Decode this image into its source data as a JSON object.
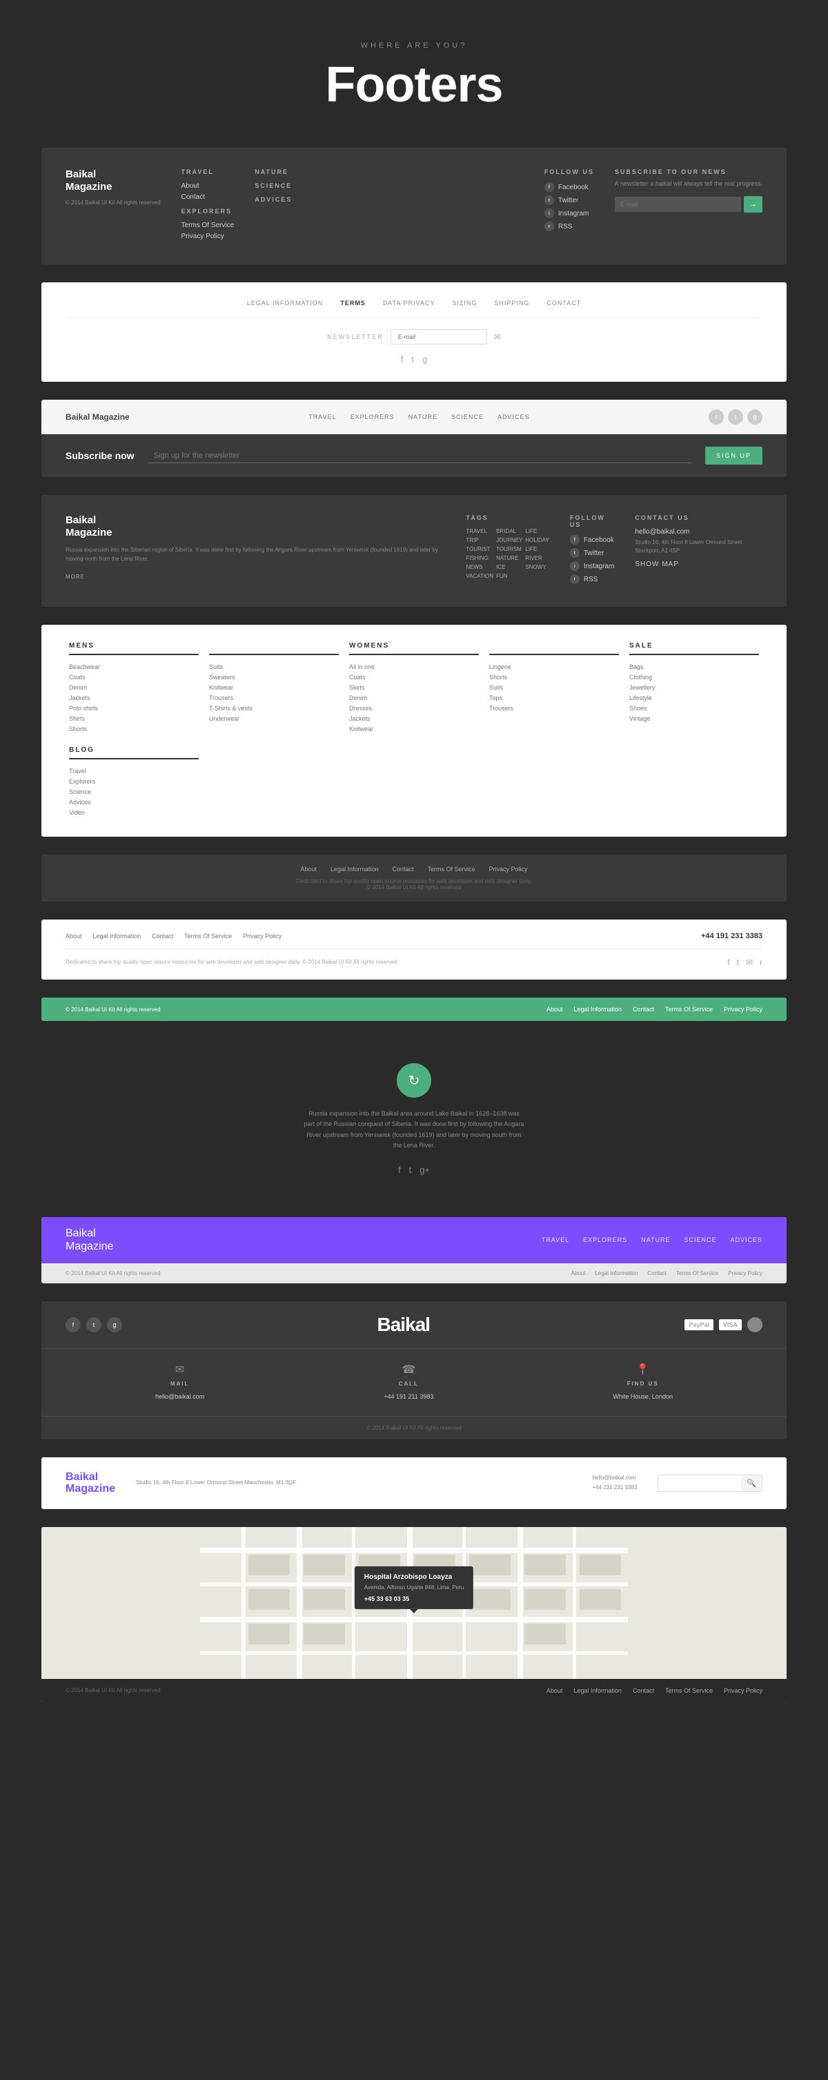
{
  "hero": {
    "subtitle": "WHERE ARE YOU?",
    "title": "Footers"
  },
  "footer1": {
    "brand_name": "Baikal",
    "brand_name2": "Magazine",
    "brand_copy": "© 2014 Baikal UI Kit\nAll rights reserved",
    "nav": {
      "col1_title": "TRAVEL",
      "col1_links": [
        "About",
        "Contact"
      ],
      "col2_title": "EXPLORERS",
      "col2_links": [
        "Terms Of Service",
        "Privacy Policy"
      ],
      "col3_title": "NATURE",
      "col4_title": "SCIENCE",
      "col5_title": "ADVICES"
    },
    "follow_title": "FOLLOW US",
    "social_links": [
      "Facebook",
      "Twitter",
      "Instagram",
      "RSS"
    ],
    "subscribe_title": "SUBSCRIBE TO OUR NEWS",
    "subscribe_desc": "A newsletter a baikal will always\ntell the real progress.",
    "subscribe_placeholder": "E-mail",
    "subscribe_btn": "→"
  },
  "footer2": {
    "nav_links": [
      "LEGAL INFORMATION",
      "TERMS",
      "DATA PRIVACY",
      "SIZING",
      "SHIPPING",
      "CONTACT"
    ],
    "newsletter_label": "NEWSLETTER",
    "newsletter_placeholder": "E-mail"
  },
  "footer3": {
    "brand": "Baikal",
    "brand2": " Magazine",
    "nav_links": [
      "TRAVEL",
      "EXPLORERS",
      "NATURE",
      "SCIENCE",
      "ADVICES"
    ]
  },
  "footer4": {
    "label": "Subscribe now",
    "placeholder": "Sign up for the newsletter",
    "btn": "SIGN UP"
  },
  "footer5": {
    "brand_name": "Baikal",
    "brand_name2": "Magazine",
    "brand_desc": "Russia expansion into the\nSiberian region of Siberia. It\nwas done first by following the\nAngara River upstream from\nYeniseisk (founded 1619) and later\nby moving north from the Lena\nRiver.",
    "more": "MORE",
    "tags_title": "TAGS",
    "tags": [
      "TRAVEL",
      "BRIDAL",
      "LIFE",
      "TRIP",
      "JOURNEY",
      "HOLIDAY",
      "TOURIST",
      "TOURISM",
      "LIFE",
      "FISHING",
      "NATURE",
      "RIVER",
      "NEWS",
      "ICE",
      "SNOWY",
      "VACATION",
      "FUN"
    ],
    "follow_title": "FOLLOW US",
    "social_links": [
      "Facebook",
      "Twitter",
      "Instagram",
      "RSS"
    ],
    "contact_title": "CONTACT US",
    "contact_email": "hello@baikal.com",
    "contact_address": "Studio 16, 4th Floor\n8 Lower Ormond Street\nStockport, A1 4SP",
    "show_map": "SHOW MAP"
  },
  "footer6": {
    "cols": [
      {
        "title": "MENS",
        "links": [
          "Beachwear",
          "Coats",
          "Denim",
          "Jackets",
          "Polo shirts",
          "Shirts",
          "Shorts"
        ]
      },
      {
        "title": "",
        "links": [
          "Suits",
          "Sweaters",
          "Knitwear",
          "Trousers",
          "T-Shirts & vests",
          "Underwear"
        ]
      },
      {
        "title": "WOMENS",
        "links": [
          "All in one",
          "Coats",
          "Skirts",
          "Denim",
          "Dresses",
          "Jackets",
          "Knitwear"
        ]
      },
      {
        "title": "",
        "links": [
          "Lingerie",
          "Shorts",
          "Suits",
          "Tops",
          "Trousers"
        ]
      },
      {
        "title": "SALE",
        "links": [
          "Bags",
          "Clothing",
          "Jewellery",
          "Lifestyle",
          "Shoes",
          "Vintage"
        ]
      },
      {
        "title": "BLOG",
        "links": [
          "Travel",
          "Explorers",
          "Science",
          "Advices",
          "Video"
        ]
      }
    ]
  },
  "footer7": {
    "nav_links": [
      "About",
      "Legal Information",
      "Contact",
      "Terms Of Service",
      "Privacy Policy"
    ],
    "copy": "Dedicated to share top quality open source resources for web developer and web designer daily.",
    "copy2": "© 2014 Baikal UI Kit All rights reserved"
  },
  "footer8": {
    "nav_links": [
      "About",
      "Legal Information",
      "Contact",
      "Terms Of Service",
      "Privacy Policy"
    ],
    "phone": "+44 191 231 3383",
    "copy": "Dedicated to share top quality open source resources for web developer and web designer daily.\n© 2014 Baikal UI Kit All rights reserved"
  },
  "footer9": {
    "copy": "© 2014 Baikal UI Kit All rights reserved",
    "nav_links": [
      "About",
      "Legal Information",
      "Contact",
      "Terms Of Service",
      "Privacy Policy"
    ]
  },
  "footer10": {
    "desc": "Russia expansion into the Baikal area around Lake Baikal in 1628–1638 was part of the Russian conquest of Siberia. It was done first by following the Angara River upstream from Yeniseisk (founded 1619) and later by moving south from the Lena River.",
    "social_links": [
      "f",
      "t",
      "g+"
    ]
  },
  "footer11": {
    "brand": "Baikal",
    "brand2": "Magazine",
    "top_nav": [
      "TRAVEL",
      "EXPLORERS",
      "NATURE",
      "SCIENCE",
      "ADVICES"
    ],
    "copy": "© 2014 Baikal UI Kit All rights reserved",
    "bottom_nav": [
      "About",
      "Legal Information",
      "Contact",
      "Terms Of Service",
      "Privacy Policy"
    ]
  },
  "footer12": {
    "brand": "Baikal",
    "payment": [
      "PayPal",
      "VISA"
    ],
    "contact": [
      {
        "label": "MAIL",
        "value": "hello@baikal.com"
      },
      {
        "label": "CALL",
        "value": "+44 191 211 3983"
      },
      {
        "label": "FIND US",
        "value": "White House, London"
      }
    ],
    "copy": "© 2014 Baikal UI Kit All rights reserved"
  },
  "footer13": {
    "brand": "Baikal",
    "brand2": "Magazine",
    "address": "Studio 16, 4th Floor 8 Lower Ormond\nStreet Manchester, M1 3QF",
    "contact_email": "hello@baikal.com",
    "contact_phone": "+44 231 231 3383",
    "search_placeholder": ""
  },
  "footer14": {
    "marker_title": "Hospital Arzobispo Loayza",
    "marker_address": "Avenida, Alfonso Ugarte 848,\nLima, Peru",
    "marker_phone": "+45 33 63 03 35",
    "copy": "© 2014 Baikal UI Kit All rights reserved",
    "nav_links": [
      "About",
      "Legal Information",
      "Contact",
      "Terms Of Service",
      "Privacy Policy"
    ]
  }
}
